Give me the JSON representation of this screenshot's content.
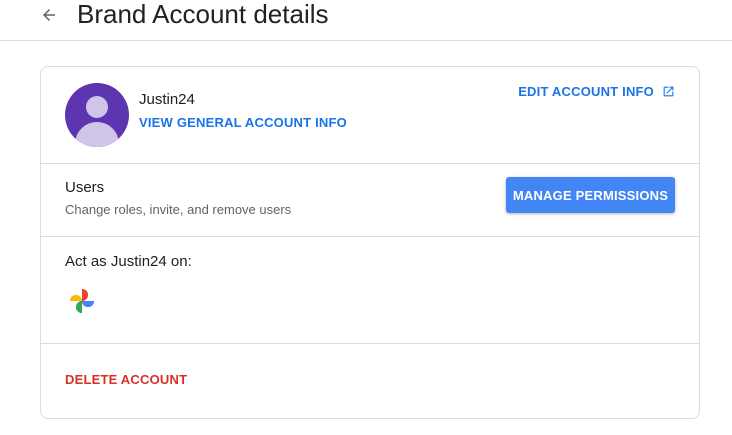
{
  "header": {
    "back_icon": "arrow-back-icon",
    "title": "Brand Account details"
  },
  "profile": {
    "account_name": "Justin24",
    "view_general_label": "VIEW GENERAL ACCOUNT INFO",
    "edit_info_label": "EDIT ACCOUNT INFO",
    "edit_icon": "open-in-new-icon",
    "avatar_color": "#5e35b1"
  },
  "users": {
    "title": "Users",
    "subtitle": "Change roles, invite, and remove users",
    "manage_label": "MANAGE PERMISSIONS"
  },
  "act_as": {
    "title": "Act as Justin24 on:",
    "services": [
      {
        "name_icon": "google-photos-icon"
      }
    ]
  },
  "danger": {
    "delete_label": "DELETE ACCOUNT",
    "color": "#d93025"
  },
  "colors": {
    "accent": "#1a73e8",
    "button": "#4285f4"
  }
}
